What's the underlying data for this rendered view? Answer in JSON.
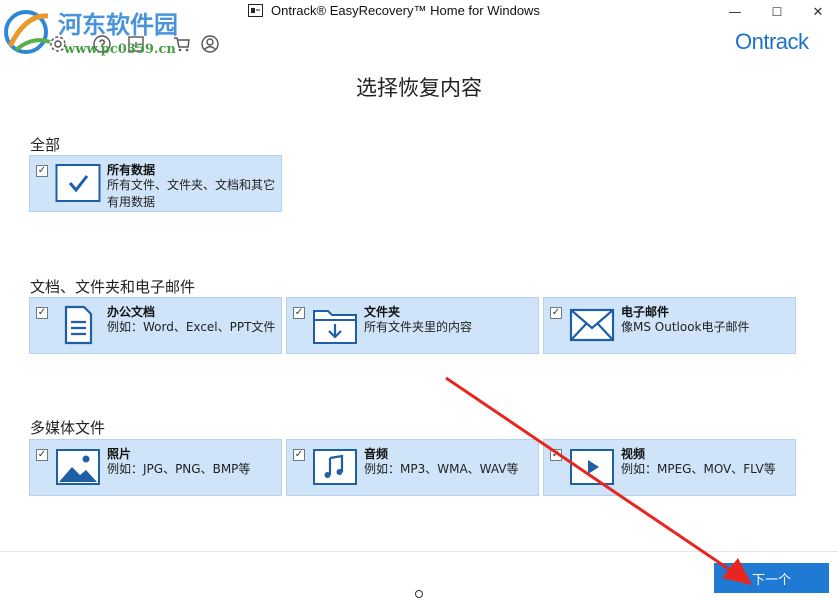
{
  "window": {
    "title": "Ontrack® EasyRecovery™ Home for Windows",
    "controls": {
      "minimize": "—",
      "maximize": "☐",
      "close": "✕"
    }
  },
  "toolbar": {
    "icons": [
      "home-icon",
      "settings-icon",
      "help-icon",
      "cart-icon",
      "account-icon"
    ],
    "brand": "Ontrack"
  },
  "watermark": {
    "site_name": "河东软件园",
    "url": "www.pc0359.cn"
  },
  "page_title": "选择恢复内容",
  "sections": [
    {
      "label": "全部",
      "items": [
        {
          "name": "所有数据",
          "desc": "所有文件、文件夹、文档和其它有用数据",
          "icon": "check-icon",
          "checked": true
        }
      ]
    },
    {
      "label": "文档、文件夹和电子邮件",
      "items": [
        {
          "name": "办公文档",
          "desc": "例如：Word、Excel、PPT文件",
          "icon": "document-icon",
          "checked": true
        },
        {
          "name": "文件夹",
          "desc": "所有文件夹里的内容",
          "icon": "folder-icon",
          "checked": true
        },
        {
          "name": "电子邮件",
          "desc": "像MS Outlook电子邮件",
          "icon": "email-icon",
          "checked": true
        }
      ]
    },
    {
      "label": "多媒体文件",
      "items": [
        {
          "name": "照片",
          "desc": "例如：JPG、PNG、BMP等",
          "icon": "photo-icon",
          "checked": true
        },
        {
          "name": "音频",
          "desc": "例如：MP3、WMA、WAV等",
          "icon": "music-icon",
          "checked": true
        },
        {
          "name": "视频",
          "desc": "例如：MPEG、MOV、FLV等",
          "icon": "video-icon",
          "checked": true
        }
      ]
    }
  ],
  "next_button": "下一个",
  "colors": {
    "accent": "#1f7ad4",
    "card_bg": "#cfe4f8",
    "brand": "#1a73c8",
    "annotation_arrow": "#e8251e"
  }
}
